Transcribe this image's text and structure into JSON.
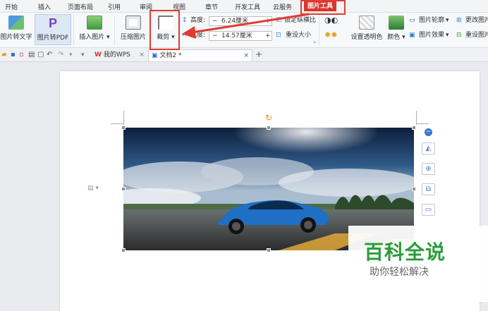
{
  "menu": {
    "items": [
      "开始",
      "插入",
      "页面布局",
      "引用",
      "审阅",
      "视图",
      "章节",
      "开发工具",
      "云服务"
    ],
    "active": "图片工具"
  },
  "ribbon": {
    "pic_to_text": "图片转文字",
    "pic_to_pdf": "图片转PDF",
    "insert_picture": "插入图片",
    "compress_picture": "压缩图片",
    "crop": "裁剪",
    "height_label": "高度:",
    "height_value": "6.24厘米",
    "width_label": "宽度:",
    "width_value": "14.57厘米",
    "lock_ratio": "锁定纵横比",
    "reset_size": "重设大小",
    "set_transparent": "设置透明色",
    "color": "颜色",
    "picture_outline": "图片轮廓",
    "picture_effect": "图片效果",
    "change_picture": "更改图片",
    "reset_picture": "重设图片",
    "minus": "−",
    "plus": "+"
  },
  "tabs": {
    "wps_tab": "我的WPS",
    "doc_tab": "文档2 *",
    "close": "×",
    "new_tab": "+"
  },
  "watermark": {
    "title": "百科全说",
    "subtitle": "助你轻松解决"
  },
  "colors": {
    "accent_red": "#e03c31",
    "active_tab": "#d9362b",
    "watermark_green": "#2a9d3a",
    "pdf_purple": "#7b3fbf"
  }
}
